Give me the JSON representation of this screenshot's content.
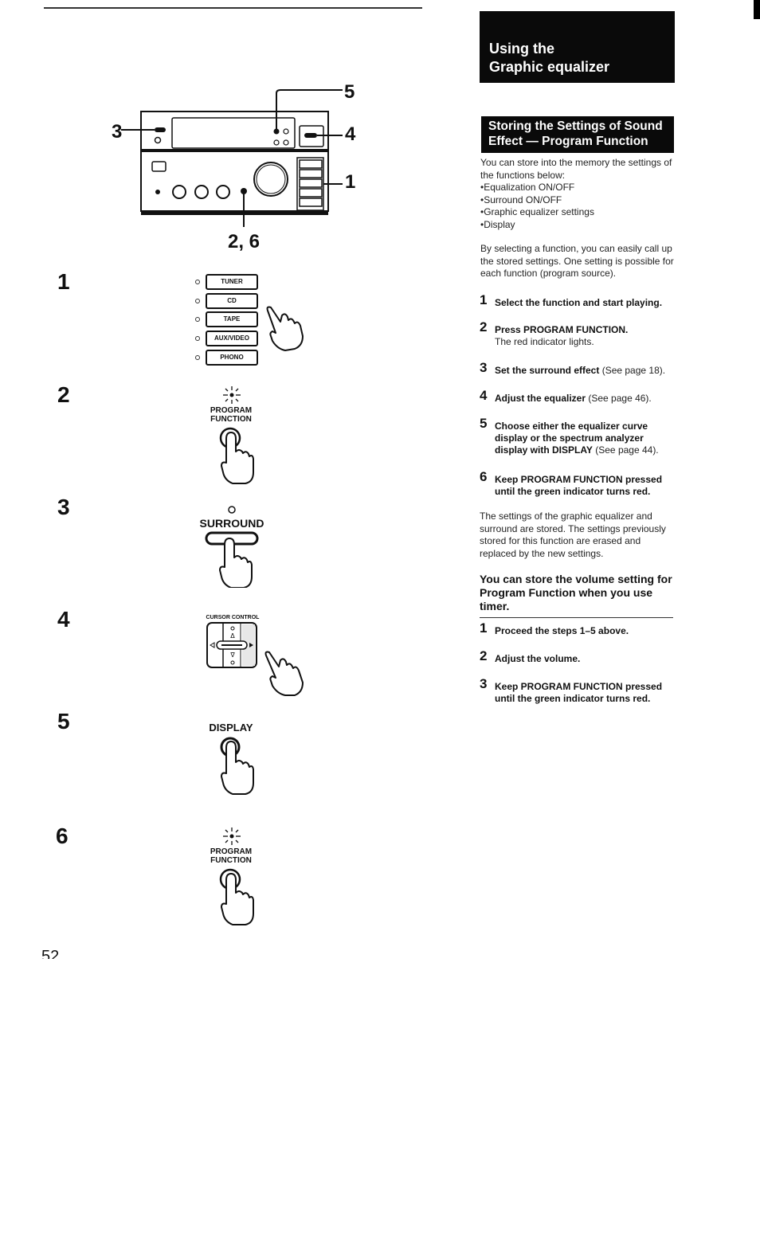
{
  "page": {
    "number": "52",
    "title": "Using the\nGraphic equalizer",
    "title_lines": [
      "Using the",
      "Graphic equalizer"
    ]
  },
  "section": {
    "title_lines": [
      "Storing the Settings of Sound",
      "Effect — Program Function"
    ],
    "intro": "You can store into the memory the settings of the functions below:",
    "bullets": [
      "Equalization ON/OFF",
      "Surround ON/OFF",
      "Graphic equalizer settings",
      "Display"
    ],
    "para2": "By selecting a function, you can easily call up the stored settings.  One setting is possible for each function (program source).",
    "steps": [
      {
        "num": "1",
        "text": "Select the function and start playing.",
        "note": "",
        "sub": ""
      },
      {
        "num": "2",
        "text": "Press PROGRAM FUNCTION.",
        "note": "",
        "sub": "The red indicator lights."
      },
      {
        "num": "3",
        "text": "Set the surround effect",
        "note": " (See page 18).",
        "sub": ""
      },
      {
        "num": "4",
        "text": "Adjust the equalizer",
        "note": " (See page 46).",
        "sub": ""
      },
      {
        "num": "5",
        "text": "Choose either the equalizer curve display or the spectrum analyzer display with DISPLAY",
        "note": " (See page 44).",
        "sub": ""
      },
      {
        "num": "6",
        "text": "Keep PROGRAM FUNCTION pressed until the green indicator turns red.",
        "note": "",
        "sub": ""
      }
    ],
    "para3": "The settings of the graphic equalizer and surround are stored.  The settings previously stored for this function are erased and replaced by the new settings."
  },
  "timer": {
    "heading": "You can store the volume setting for Program Function when you use timer.",
    "steps": [
      {
        "num": "1",
        "text": "Proceed the steps 1–5 above."
      },
      {
        "num": "2",
        "text": "Adjust the volume."
      },
      {
        "num": "3",
        "text": "Keep PROGRAM FUNCTION pressed until the green indicator turns red."
      }
    ]
  },
  "diagram": {
    "callouts": {
      "c1": "1",
      "c3": "3",
      "c4": "4",
      "c5": "5",
      "c26": "2, 6"
    },
    "step_numbers": [
      "1",
      "2",
      "3",
      "4",
      "5",
      "6"
    ],
    "source_buttons": [
      "TUNER",
      "CD",
      "TAPE",
      "AUX/VIDEO",
      "PHONO"
    ],
    "program_function_label": [
      "PROGRAM",
      "FUNCTION"
    ],
    "surround_label": "SURROUND",
    "cursor_control_label": "CURSOR CONTROL",
    "display_label": "DISPLAY"
  }
}
